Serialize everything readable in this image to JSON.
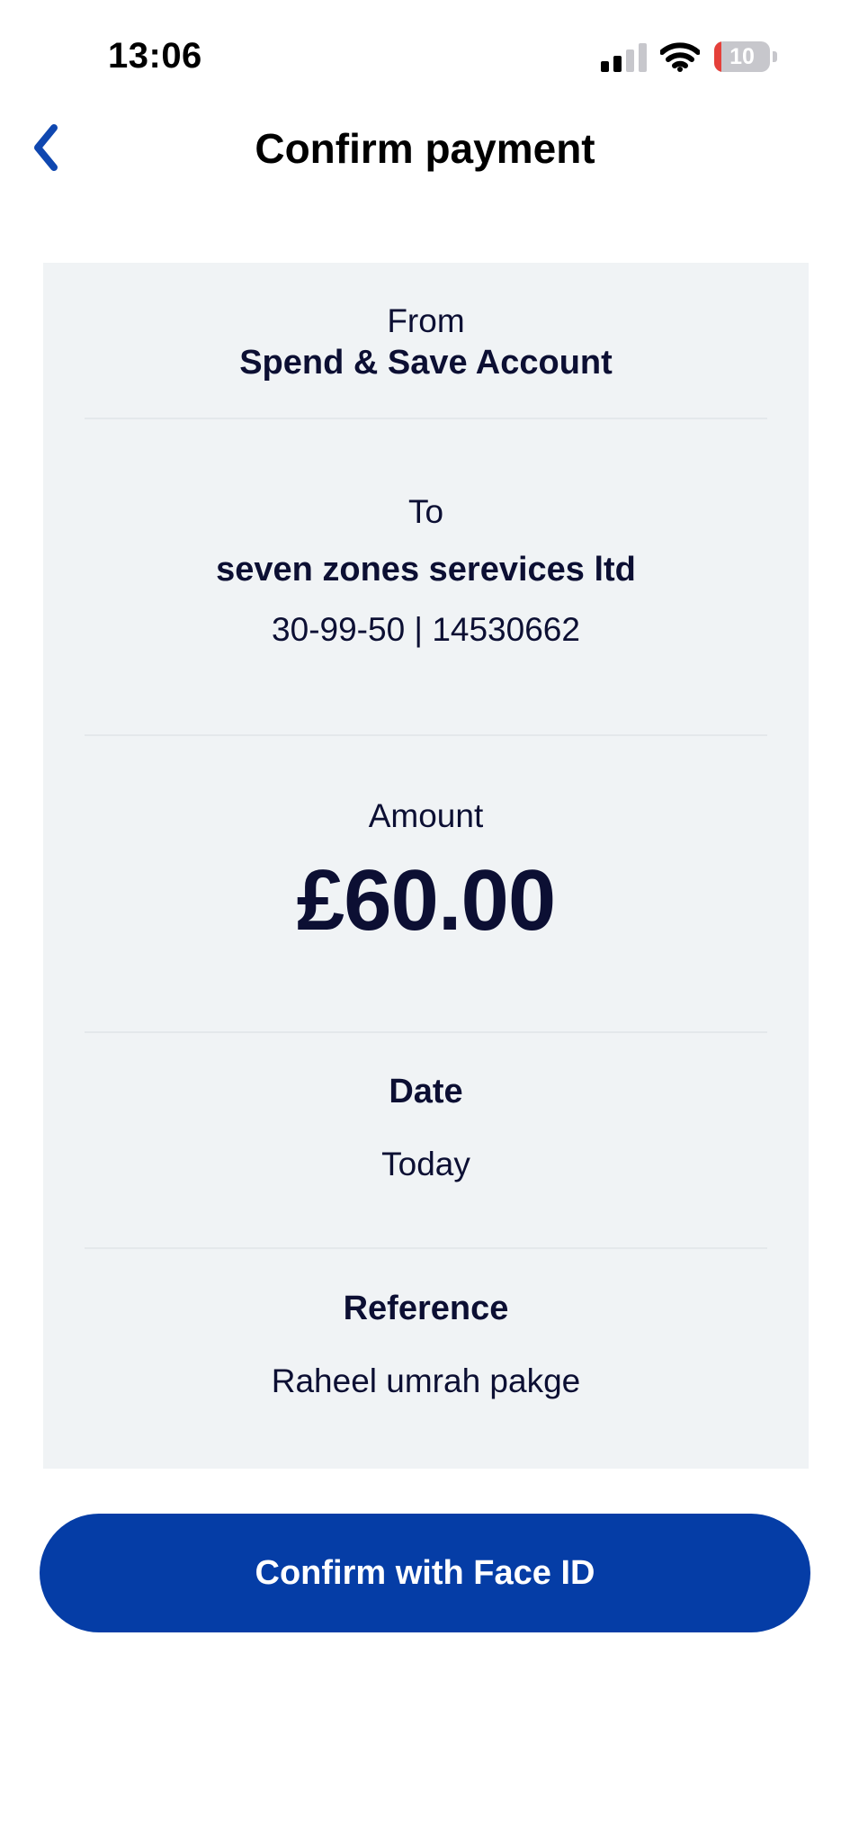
{
  "status_bar": {
    "time": "13:06",
    "battery_level": "10",
    "battery_fraction": 0.1,
    "icons": [
      "signal-icon",
      "wifi-icon",
      "battery-icon"
    ]
  },
  "header": {
    "title": "Confirm payment",
    "back_icon": "chevron-left-icon"
  },
  "payment": {
    "from_label": "From",
    "from_account": "Spend & Save Account",
    "to_label": "To",
    "payee_name": "seven zones serevices ltd",
    "payee_details": "30-99-50 | 14530662",
    "amount_label": "Amount",
    "amount": "£60.00",
    "date_label": "Date",
    "date_value": "Today",
    "reference_label": "Reference",
    "reference_value": "Raheel umrah pakge"
  },
  "actions": {
    "confirm_label": "Confirm with Face ID"
  },
  "colors": {
    "accent": "#053da6",
    "back_icon": "#0f47b0",
    "card_background": "#f0f3f5",
    "text": "#0c0f33",
    "battery_low": "#e5403a"
  }
}
